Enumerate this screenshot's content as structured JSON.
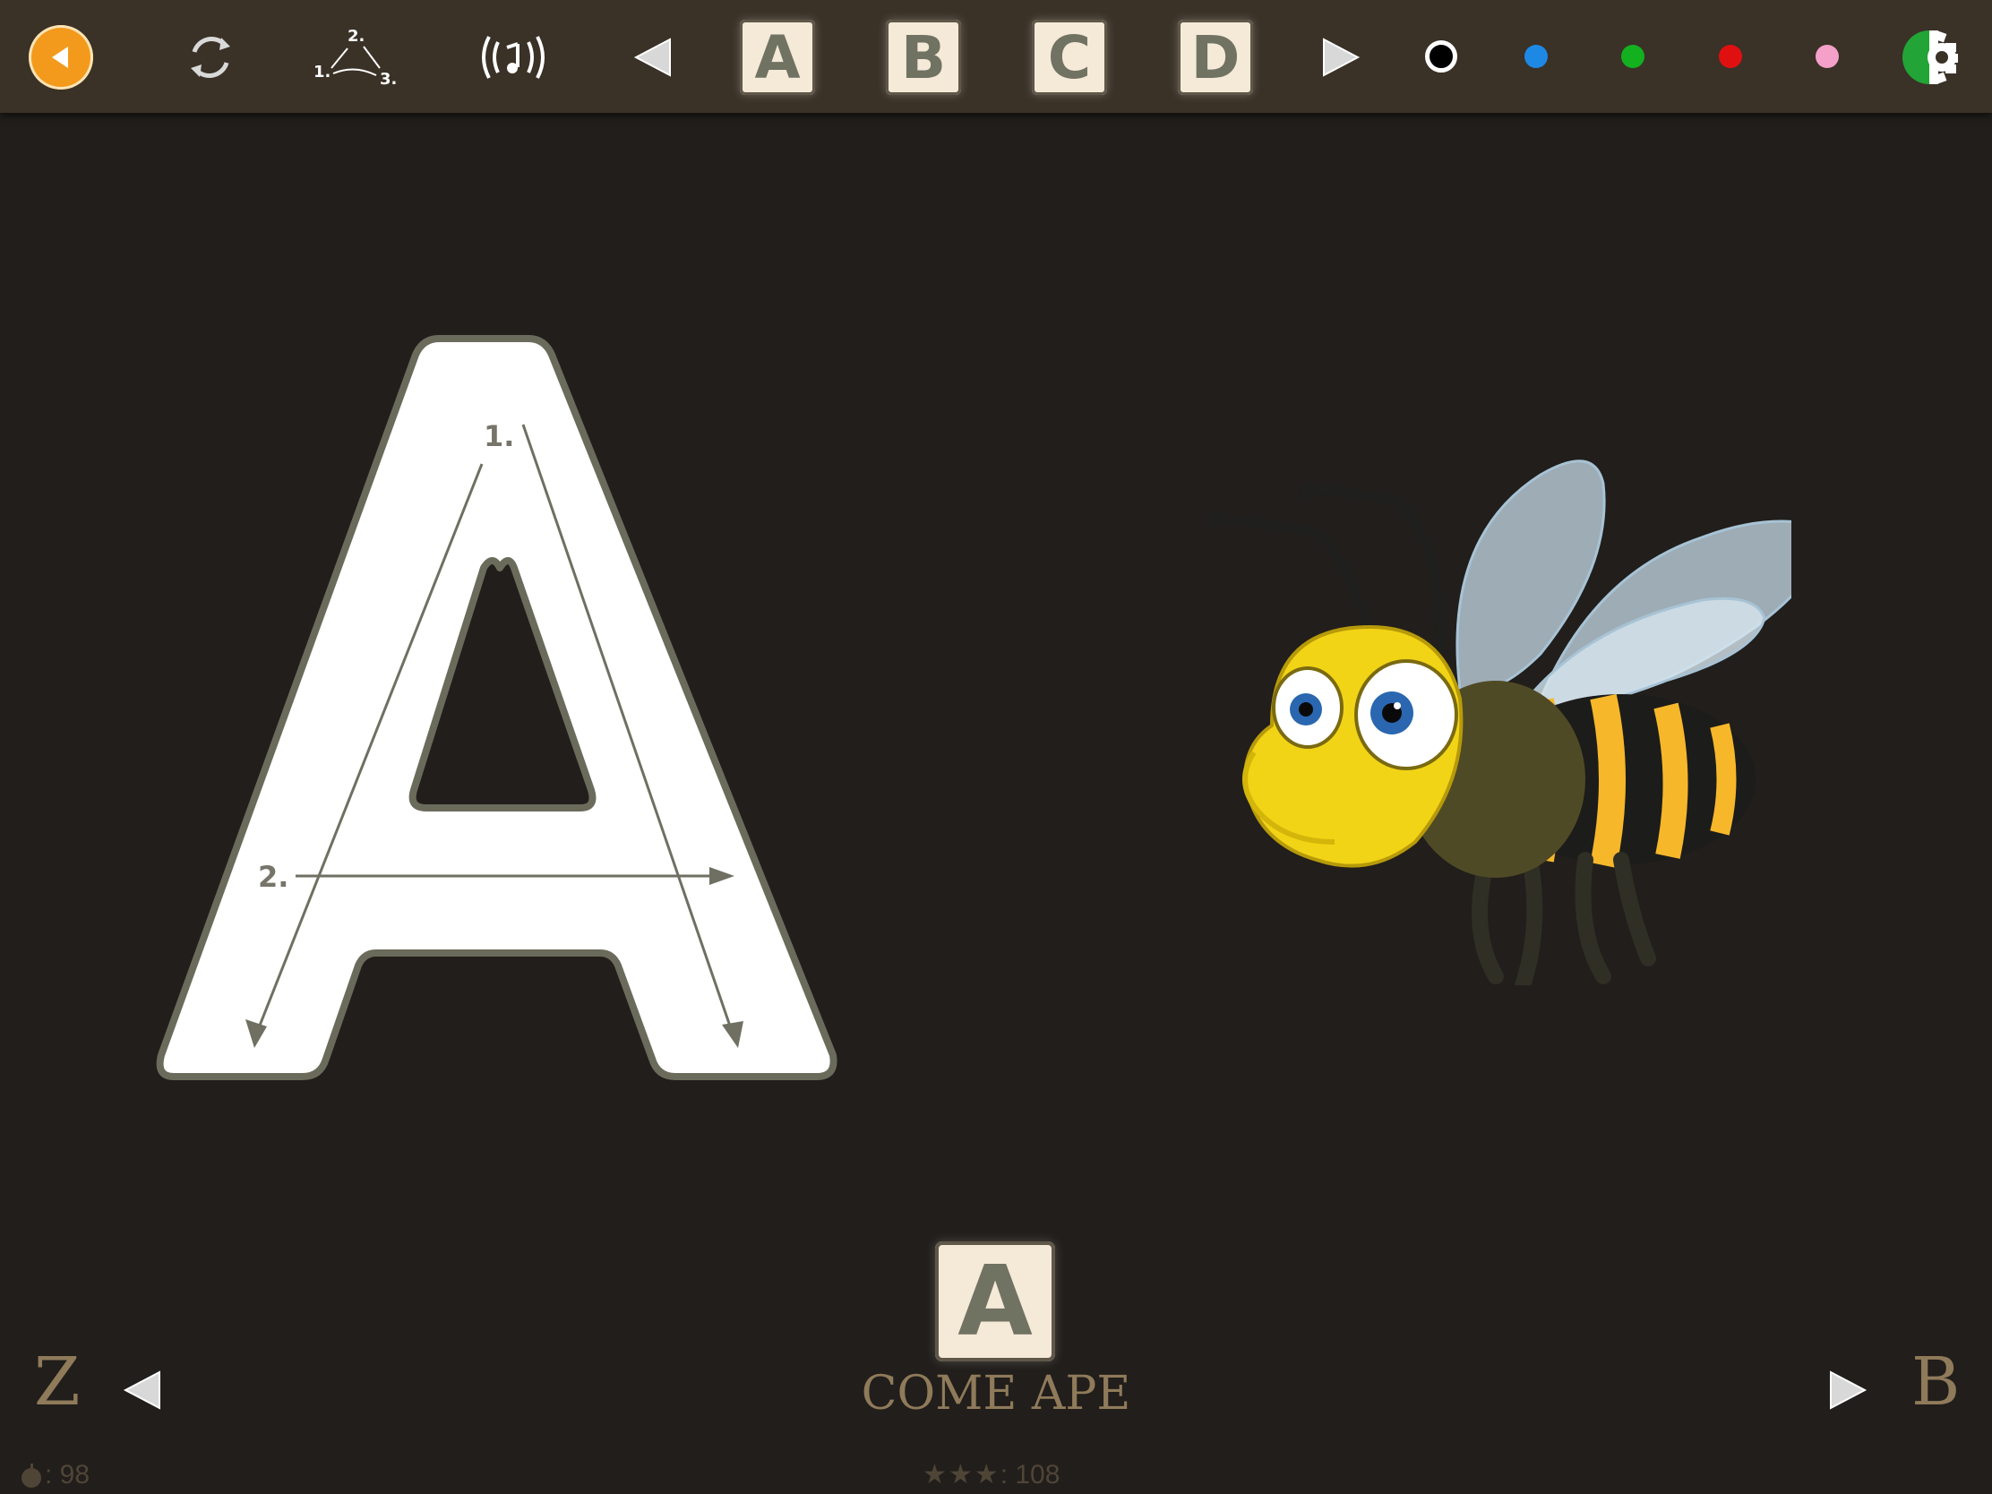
{
  "toolbar": {
    "icons": {
      "back": "back-icon",
      "refresh": "refresh-icon",
      "stroke_order": "stroke-order-icon",
      "sound": "sound-icon",
      "prev": "triangle-left-icon",
      "next": "triangle-right-icon",
      "settings": "settings-icon"
    },
    "stroke_order_numbers": [
      "1.",
      "2.",
      "3."
    ],
    "letters": [
      "A",
      "B",
      "C",
      "D"
    ],
    "colors": [
      "#000000",
      "#1e88e5",
      "#13b020",
      "#e01010",
      "#f5a0c8"
    ],
    "selected_color": "#000000"
  },
  "tracing": {
    "letter": "A",
    "stroke_labels": [
      "1.",
      "2."
    ]
  },
  "picture": {
    "subject": "bee-illustration"
  },
  "footer": {
    "prev_letter": "Z",
    "next_letter": "B",
    "current_letter": "A",
    "word": "COME APE",
    "apples": ": 98",
    "stars": ": 108"
  }
}
